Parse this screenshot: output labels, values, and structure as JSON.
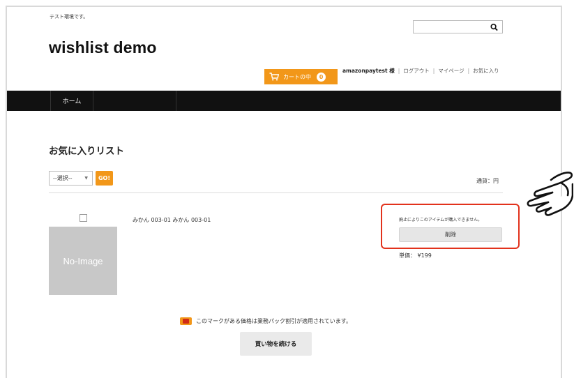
{
  "header": {
    "env_text": "テスト環境です。",
    "logo": "wishlist demo",
    "search": {
      "placeholder": "",
      "icon": "search-icon"
    },
    "cart": {
      "label": "カートの中",
      "count": "0",
      "icon": "cart-icon"
    },
    "user_nav": {
      "username": "amazonpaytest 様",
      "links": [
        "ログアウト",
        "マイページ",
        "お気に入り"
      ]
    }
  },
  "navbar": {
    "items": [
      "ホーム"
    ]
  },
  "main": {
    "title": "お気に入りリスト",
    "select_value": "--選択--",
    "go_label": "GO!",
    "currency": "通貨：円",
    "item": {
      "image_label": "No-Image",
      "name": "みかん 003-01 みかん 003-01",
      "unavailable_msg": "廃止によりこのアイテムが購入できません。",
      "delete_label": "削除",
      "price": "単価： ¥199"
    },
    "pack_note": "このマークがある価格は業務パック割引が適用されています。",
    "continue_label": "買い物を続ける"
  },
  "colors": {
    "accent": "#f29719",
    "highlight": "#e2321c",
    "navbar": "#111111"
  }
}
